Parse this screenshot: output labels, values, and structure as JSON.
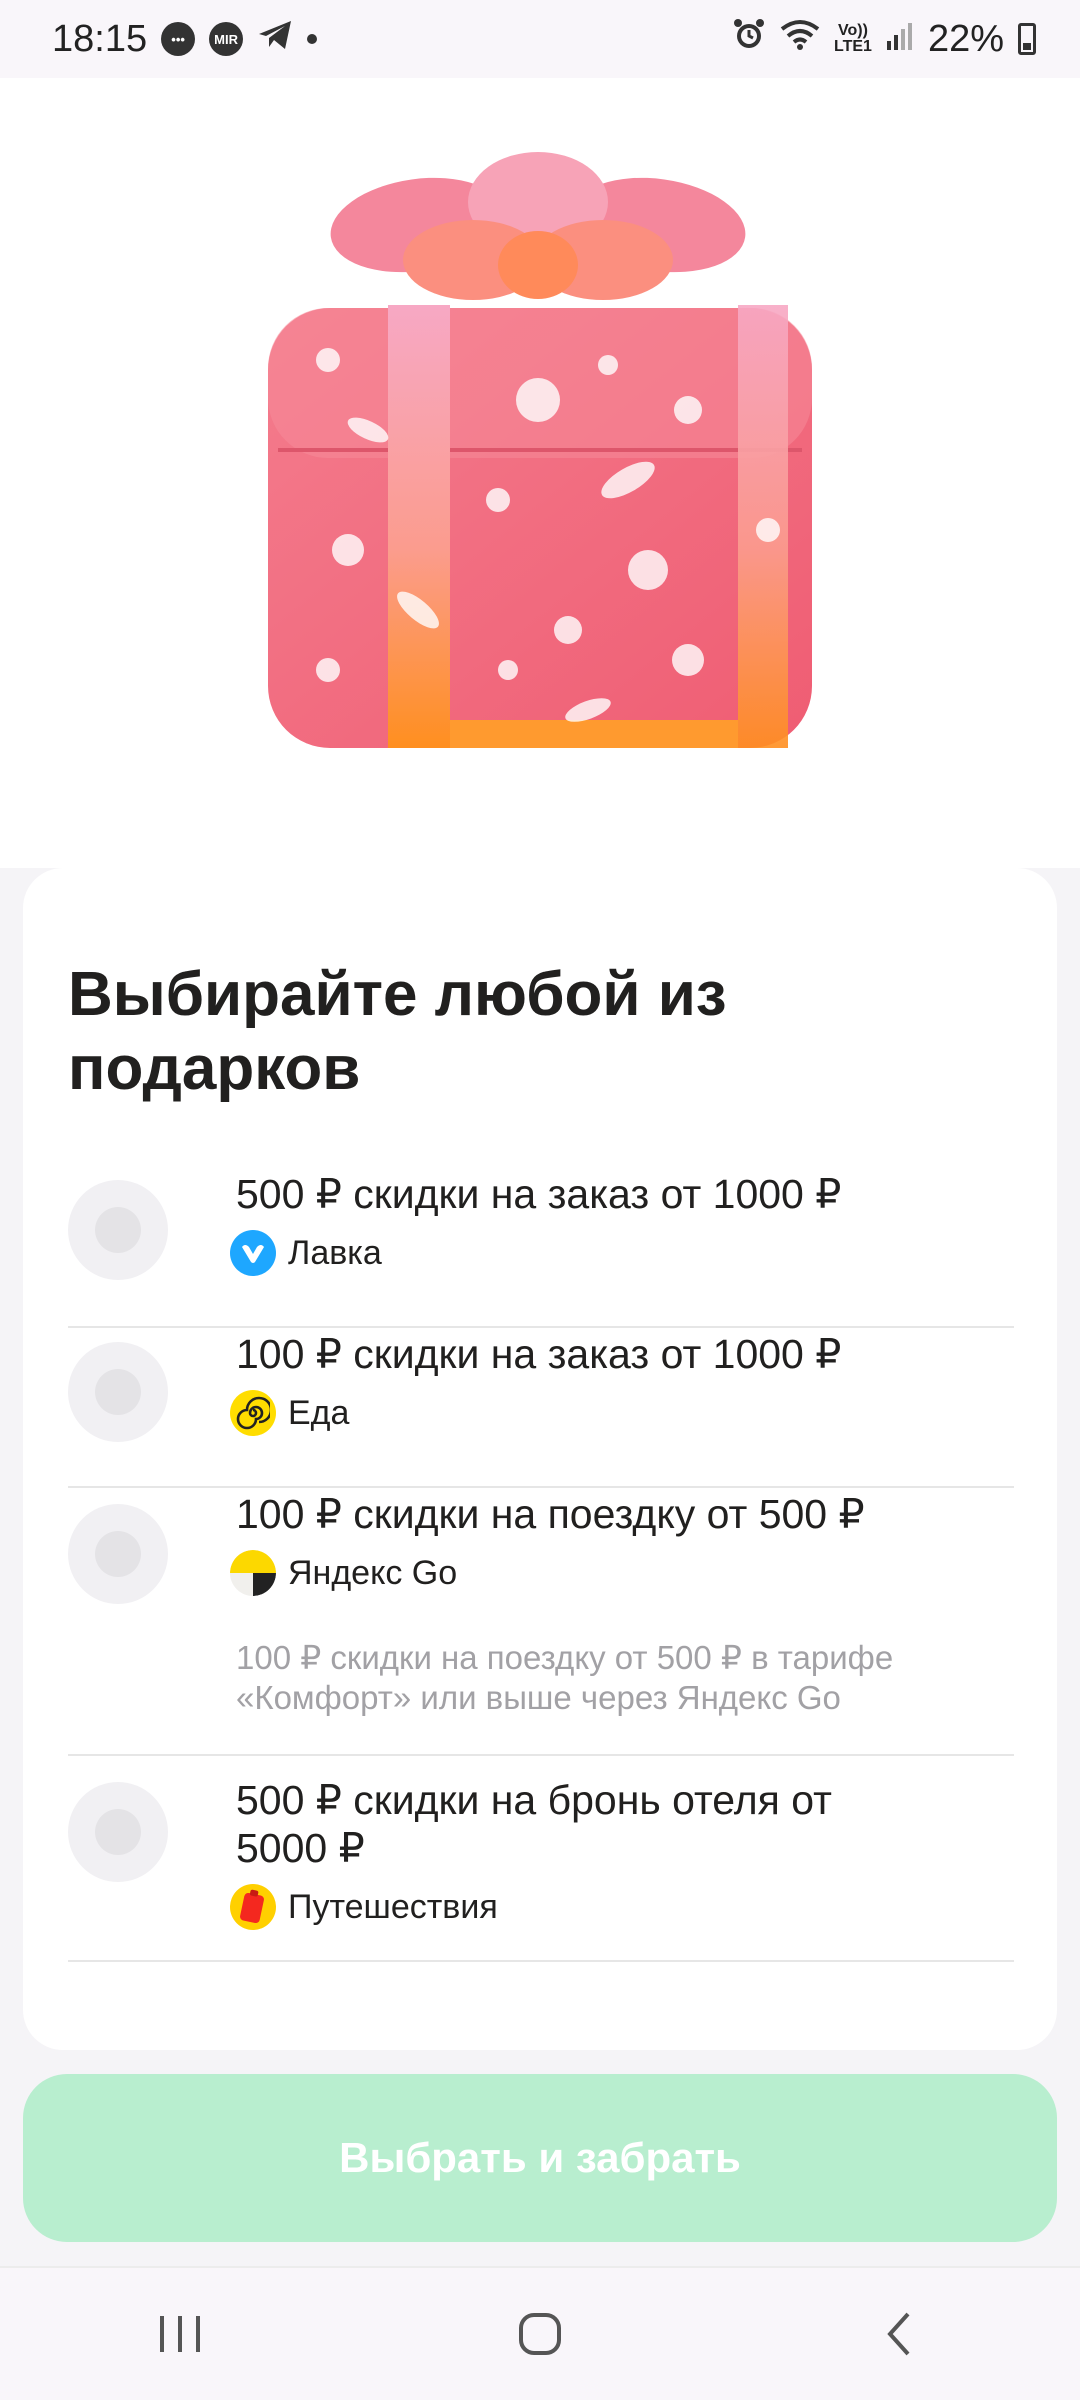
{
  "status_bar": {
    "time": "18:15",
    "battery": "22%",
    "volte_top": "Vo))",
    "volte_bottom": "LTE1",
    "notif_icons": [
      "chat-icon",
      "mir-icon",
      "telegram-icon",
      "dot-icon"
    ],
    "system_icons": [
      "alarm-icon",
      "wifi-icon",
      "volte-icon",
      "signal-icon",
      "battery-icon"
    ]
  },
  "hero": {
    "image": "gift-box-illustration"
  },
  "card": {
    "title": "Выбирайте любой из подарков",
    "options": [
      {
        "title": "500 ₽ скидки на заказ от 1000 ₽",
        "service": "Лавка",
        "icon": "lavka-icon",
        "selected": false
      },
      {
        "title": "100 ₽ скидки на заказ от 1000 ₽",
        "service": "Еда",
        "icon": "eda-icon",
        "selected": false
      },
      {
        "title": "100 ₽ скидки на поездку от 500 ₽",
        "service": "Яндекс Go",
        "icon": "yandex-go-icon",
        "note": "100 ₽ скидки на поездку от 500 ₽ в тарифе «Комфорт» или выше через Яндекс Go",
        "selected": false
      },
      {
        "title": "500 ₽ скидки на бронь отеля от 5000 ₽",
        "service": "Путешествия",
        "icon": "travel-icon",
        "selected": false
      }
    ]
  },
  "action": {
    "label": "Выбрать и забрать",
    "enabled": false
  },
  "nav": [
    "recent-apps-icon",
    "home-icon",
    "back-icon"
  ],
  "colors": {
    "button_disabled": "#b8eecf",
    "gift_pink": "#f27284",
    "ribbon_orange": "#ff9a3c",
    "lavka_blue": "#1ea7ff",
    "eda_yellow": "#ffdd00"
  }
}
